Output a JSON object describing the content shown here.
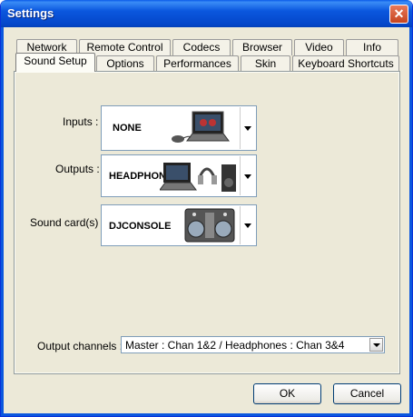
{
  "window": {
    "title": "Settings"
  },
  "tabs_back": [
    "Network",
    "Remote Control",
    "Codecs",
    "Browser",
    "Video",
    "Info"
  ],
  "tabs_front": [
    "Sound Setup",
    "Options",
    "Performances",
    "Skin",
    "Keyboard Shortcuts"
  ],
  "active_tab": "Sound Setup",
  "inputs": {
    "label": "Inputs :",
    "value": "NONE"
  },
  "outputs": {
    "label": "Outputs :",
    "value": "HEADPHONES"
  },
  "sound_card": {
    "label": "Sound card(s) :",
    "value": "DJCONSOLE"
  },
  "output_channels": {
    "label": "Output channels :",
    "value": "Master : Chan 1&2 / Headphones : Chan 3&4"
  },
  "buttons": {
    "ok": "OK",
    "cancel": "Cancel"
  }
}
